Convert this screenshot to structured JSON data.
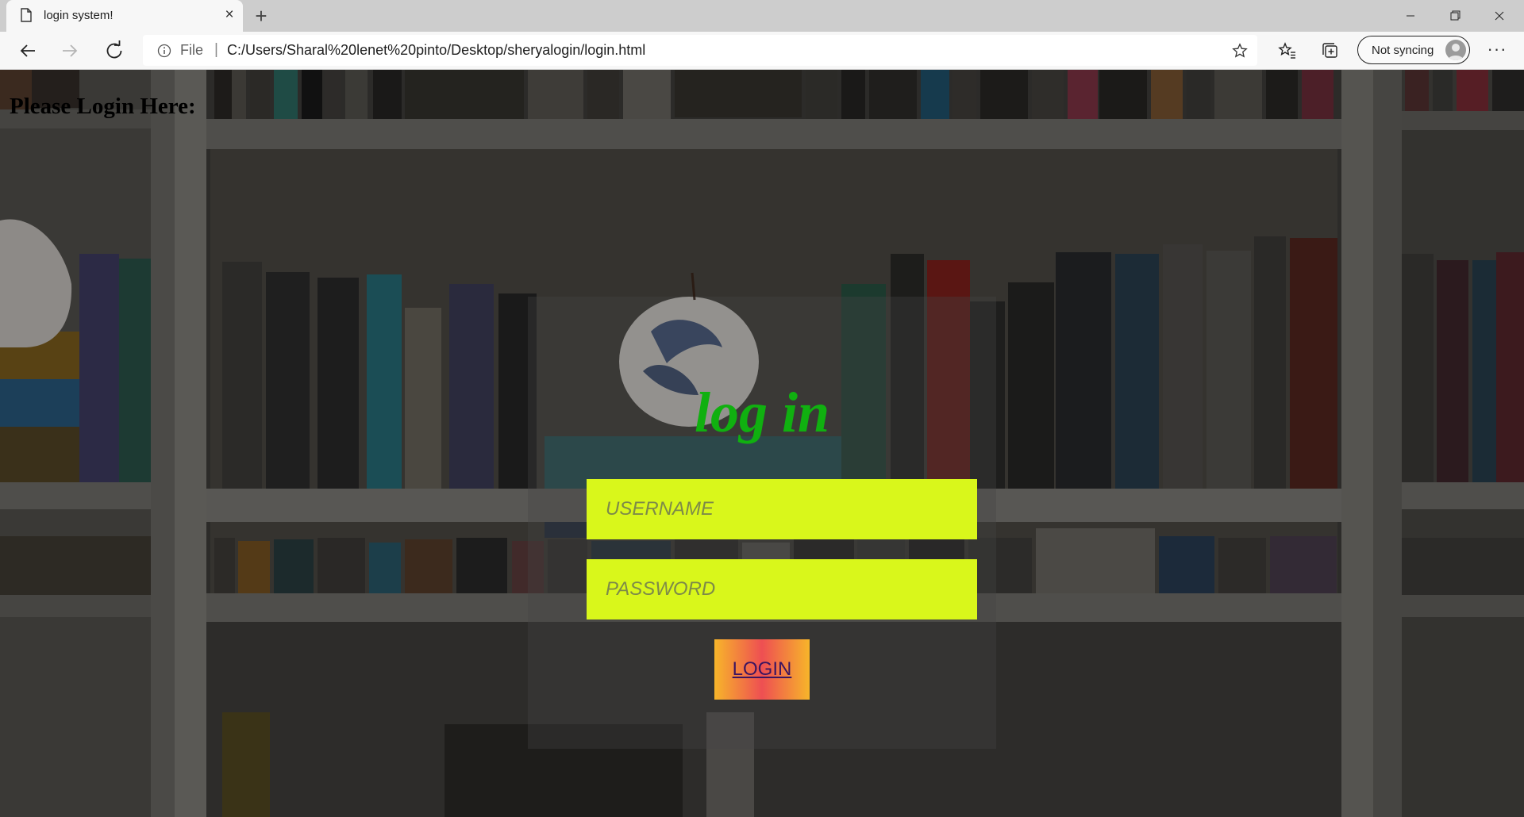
{
  "browser": {
    "tab": {
      "title": "login system!"
    },
    "address": {
      "scheme": "File",
      "url": "C:/Users/Sharal%20lenet%20pinto/Desktop/sheryalogin/login.html"
    },
    "profile": {
      "sync_label": "Not syncing"
    },
    "more_label": "···"
  },
  "page": {
    "heading": "Please Login Here:",
    "form": {
      "title": "log in",
      "username_placeholder": "USERNAME",
      "password_placeholder": "PASSWORD",
      "login_label": "LOGIN"
    }
  },
  "colors": {
    "input_bg": "#d9f71b",
    "title_green": "#10b010",
    "button_gradient": [
      "#f7b52a",
      "#ee4f52"
    ]
  }
}
